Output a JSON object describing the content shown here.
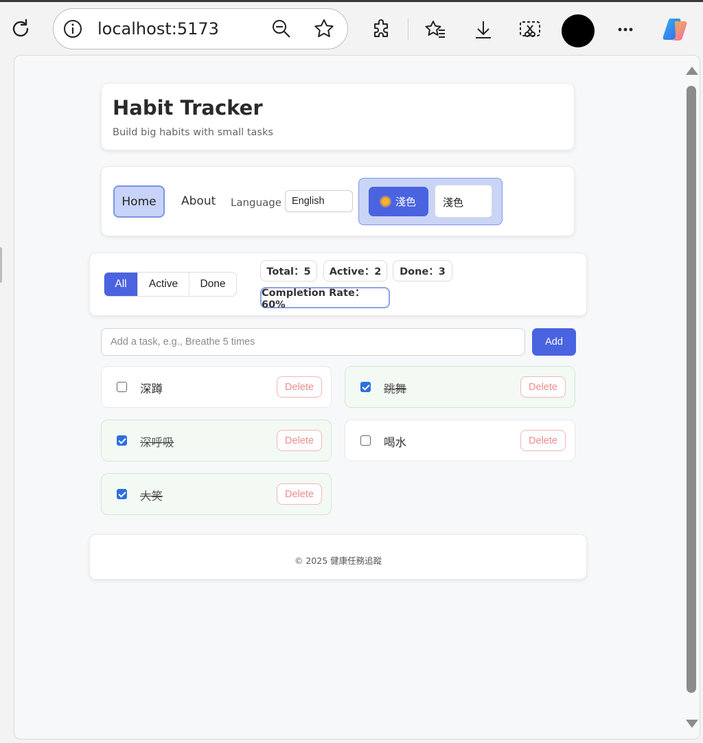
{
  "browser": {
    "url": "localhost:5173"
  },
  "header": {
    "title": "Habit Tracker",
    "subtitle": "Build big habits with small tasks"
  },
  "nav": {
    "home": "Home",
    "about": "About",
    "language_label": "Language",
    "language_value": "English",
    "theme_button": "淺色",
    "theme_select": "淺色"
  },
  "filters": {
    "all": "All",
    "active": "Active",
    "done": "Done",
    "selected": "All"
  },
  "stats": {
    "total": "Total：5",
    "active": "Active：2",
    "done": "Done：3",
    "rate": "Completion Rate：60%"
  },
  "add_task": {
    "placeholder": "Add a task, e.g., Breathe 5 times",
    "button": "Add"
  },
  "tasks": [
    {
      "name": "深蹲",
      "done": false,
      "delete": "Delete"
    },
    {
      "name": "跳舞",
      "done": true,
      "delete": "Delete"
    },
    {
      "name": "深呼吸",
      "done": true,
      "delete": "Delete"
    },
    {
      "name": "喝水",
      "done": false,
      "delete": "Delete"
    },
    {
      "name": "大笑",
      "done": true,
      "delete": "Delete"
    }
  ],
  "footer": {
    "text": "© 2025 健康任務追蹤"
  },
  "colors": {
    "accent": "#4a63e0",
    "done_bg": "#f3faf4",
    "delete": "#ef8b8b"
  }
}
